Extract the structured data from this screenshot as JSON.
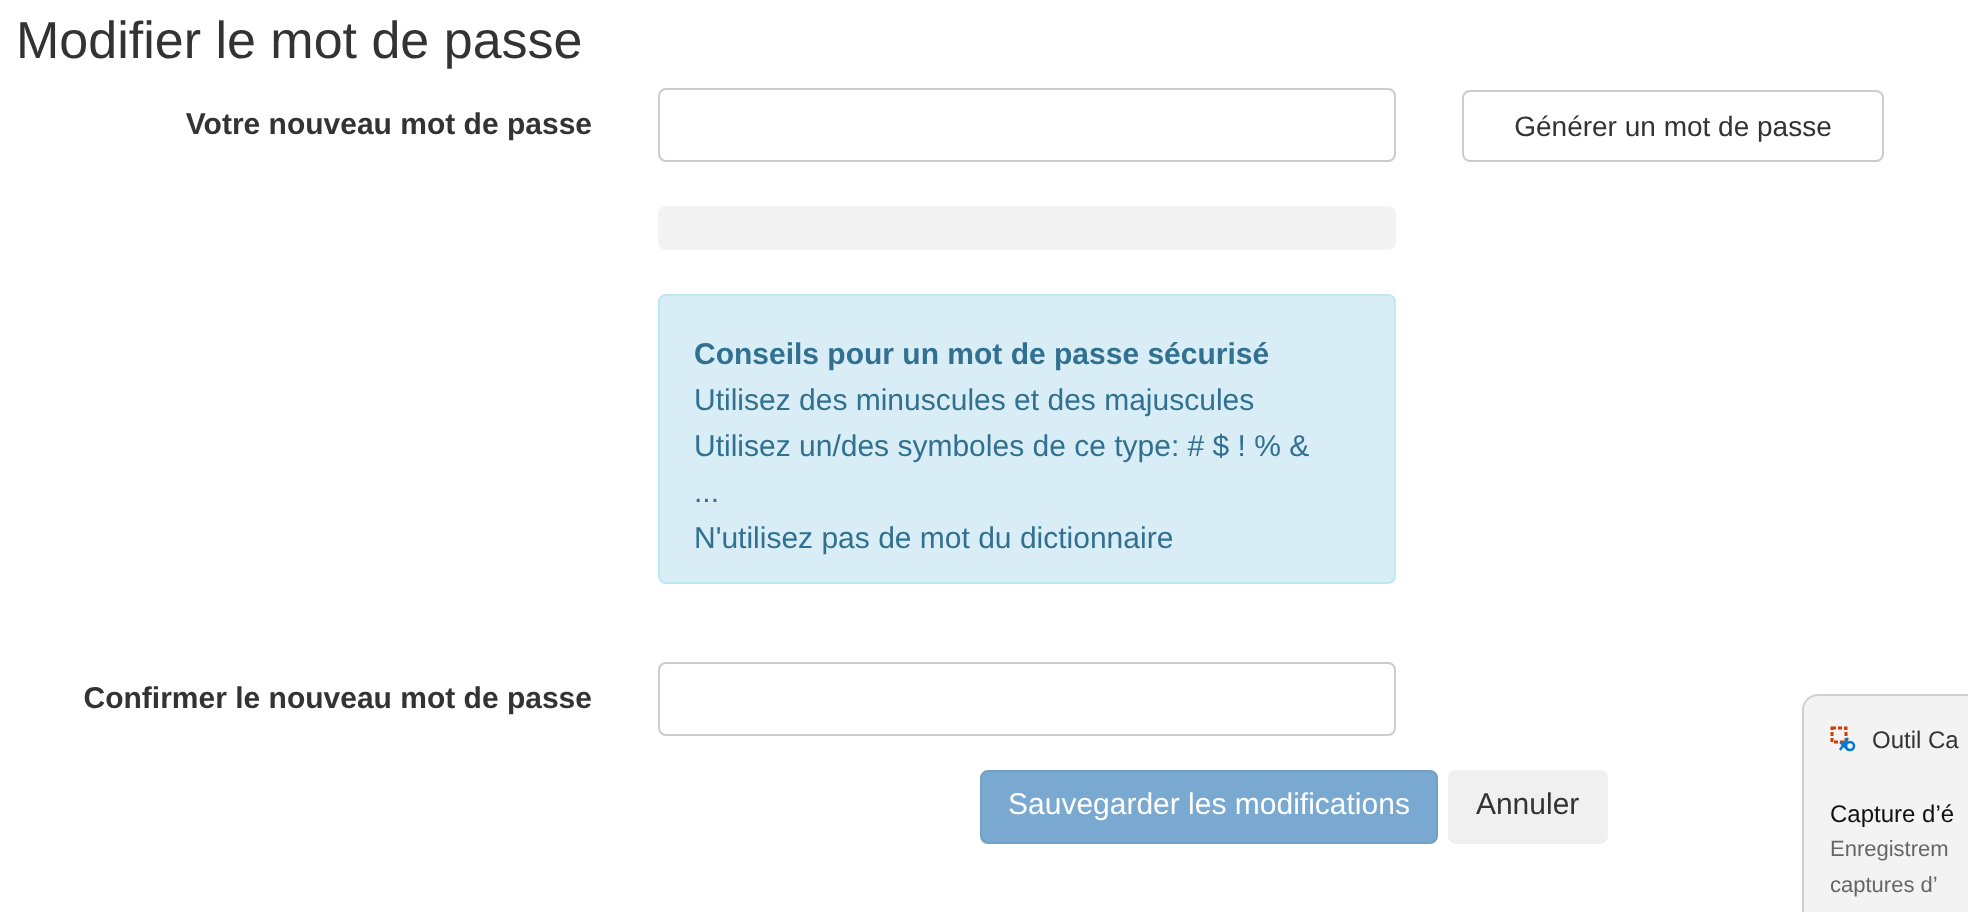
{
  "title": "Modifier le mot de passe",
  "new_password": {
    "label": "Votre nouveau mot de passe",
    "generate_button": "Générer un mot de passe",
    "strength_meter": {
      "level": 0
    }
  },
  "tips": {
    "heading": "Conseils pour un mot de passe sécurisé",
    "lines": [
      "Utilisez des minuscules et des majuscules",
      "Utilisez un/des symboles de ce type: # $ ! % &",
      "...",
      "N'utilisez pas de mot du dictionnaire"
    ]
  },
  "confirm_password": {
    "label": "Confirmer le nouveau mot de passe"
  },
  "buttons": [
    {
      "label": "Sauvegarder les modifications",
      "kind": "primary",
      "disabled": true
    },
    {
      "label": "Annuler",
      "kind": "secondary",
      "disabled": false
    }
  ],
  "notification": {
    "app": "Outil Ca",
    "title": "Capture d’é",
    "lines": [
      "Enregistrem",
      "captures d’"
    ]
  }
}
